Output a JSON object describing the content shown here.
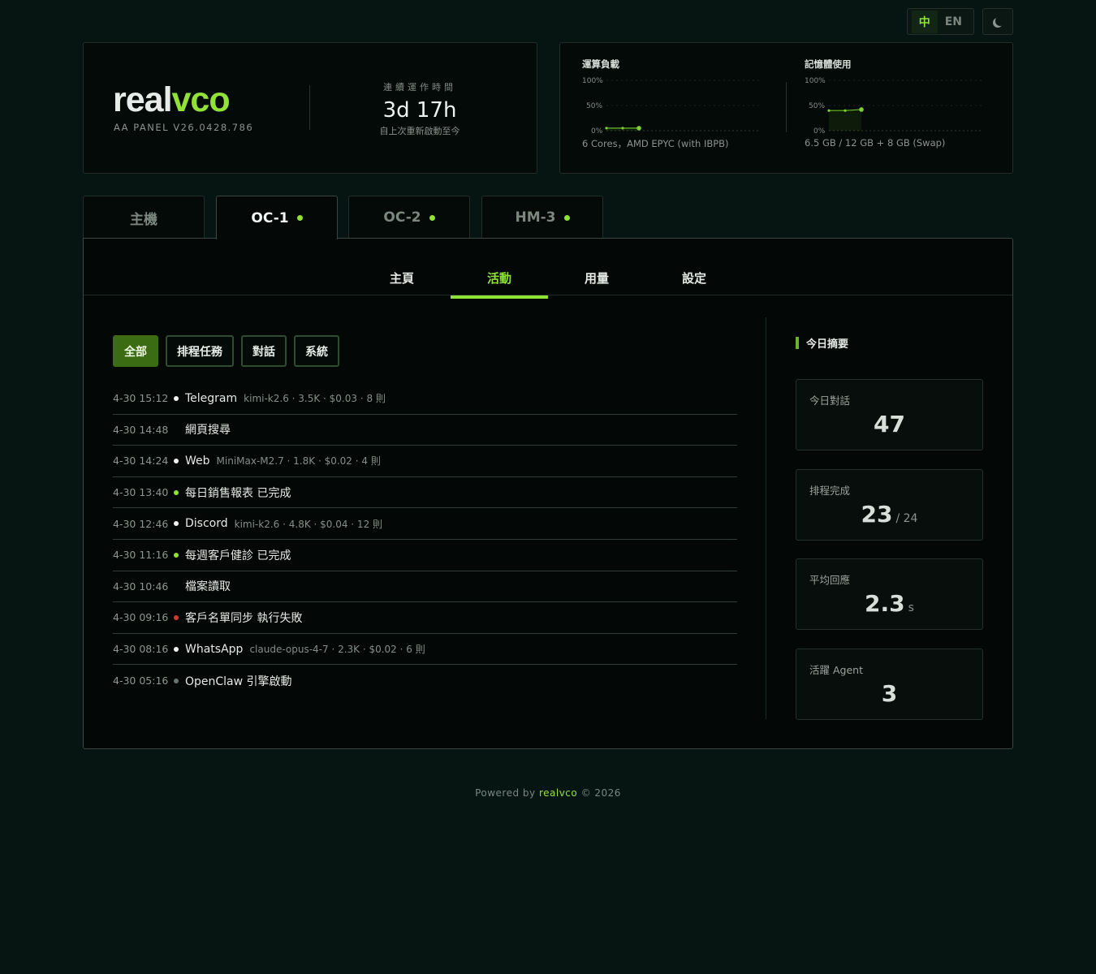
{
  "topbar": {
    "lang_zh": "中",
    "lang_en": "EN",
    "theme_icon": "moon-icon"
  },
  "brand": {
    "logo_main": "real",
    "logo_accent": "vco",
    "version": "AA PANEL V26.0428.786"
  },
  "uptime": {
    "label": "連續運作時間",
    "value": "3d 17h",
    "sub": "自上次重新啟動至今"
  },
  "cpu": {
    "title": "運算負載",
    "ticks": [
      "100%",
      "50%",
      "0%"
    ],
    "foot": "6 Cores，AMD EPYC (with IBPB)",
    "series": [
      0.05,
      0.05,
      0.05
    ]
  },
  "memory": {
    "title": "記憶體使用",
    "ticks": [
      "100%",
      "50%",
      "0%"
    ],
    "foot": "6.5 GB / 12 GB + 8 GB (Swap)",
    "series": [
      0.4,
      0.4,
      0.42
    ]
  },
  "host_tabs": [
    {
      "label": "主機",
      "online": false,
      "active": false
    },
    {
      "label": "OC-1",
      "online": true,
      "active": true
    },
    {
      "label": "OC-2",
      "online": true,
      "active": false
    },
    {
      "label": "HM-3",
      "online": true,
      "active": false
    }
  ],
  "sub_tabs": [
    "主頁",
    "活動",
    "用量",
    "設定"
  ],
  "active_sub_tab": 1,
  "filters": [
    "全部",
    "排程任務",
    "對話",
    "系統"
  ],
  "active_filter": 0,
  "feed": [
    {
      "time": "4-30 15:12",
      "dot": "white",
      "main": "Telegram",
      "meta": "kimi-k2.6 · 3.5K · $0.03 · 8 則"
    },
    {
      "time": "4-30 14:48",
      "dot": "none",
      "main": "網頁搜尋",
      "meta": ""
    },
    {
      "time": "4-30 14:24",
      "dot": "white",
      "main": "Web",
      "meta": "MiniMax-M2.7 · 1.8K · $0.02 · 4 則"
    },
    {
      "time": "4-30 13:40",
      "dot": "green",
      "main": "每日銷售報表 已完成",
      "meta": ""
    },
    {
      "time": "4-30 12:46",
      "dot": "white",
      "main": "Discord",
      "meta": "kimi-k2.6 · 4.8K · $0.04 · 12 則"
    },
    {
      "time": "4-30 11:16",
      "dot": "green",
      "main": "每週客戶健診 已完成",
      "meta": ""
    },
    {
      "time": "4-30 10:46",
      "dot": "none",
      "main": "檔案讀取",
      "meta": ""
    },
    {
      "time": "4-30 09:16",
      "dot": "red",
      "main": "客戶名單同步 執行失敗",
      "meta": ""
    },
    {
      "time": "4-30 08:16",
      "dot": "white",
      "main": "WhatsApp",
      "meta": "claude-opus-4-7 · 2.3K · $0.02 · 6 則"
    },
    {
      "time": "4-30 05:16",
      "dot": "grey",
      "main": "OpenClaw 引擎啟動",
      "meta": ""
    }
  ],
  "summary": {
    "title": "今日摘要",
    "cards": [
      {
        "label": "今日對話",
        "value": "47",
        "unit": ""
      },
      {
        "label": "排程完成",
        "value": "23",
        "unit": "/ 24"
      },
      {
        "label": "平均回應",
        "value": "2.3",
        "unit": "s"
      },
      {
        "label": "活躍 Agent",
        "value": "3",
        "unit": ""
      }
    ]
  },
  "footer": {
    "prefix": "Powered by",
    "brand": "realvco",
    "suffix": "© 2026"
  },
  "colors": {
    "accent": "#8fe335",
    "background": "#061512",
    "error": "#d23a2a"
  }
}
